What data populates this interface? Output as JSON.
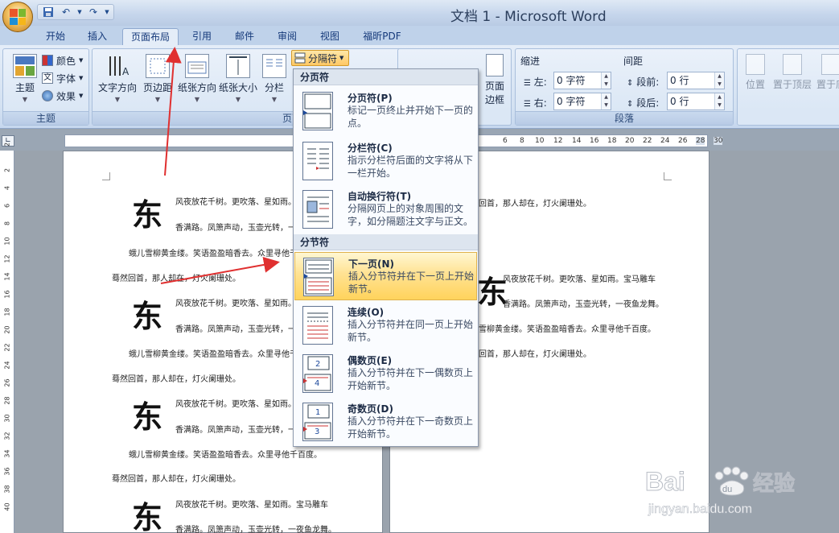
{
  "window": {
    "title": "文档 1 - Microsoft Word"
  },
  "tabs": [
    {
      "label": "开始"
    },
    {
      "label": "插入"
    },
    {
      "label": "页面布局"
    },
    {
      "label": "引用"
    },
    {
      "label": "邮件"
    },
    {
      "label": "审阅"
    },
    {
      "label": "视图"
    },
    {
      "label": "福昕PDF"
    }
  ],
  "ribbon": {
    "theme_group": {
      "label": "主题",
      "theme": "主题",
      "colors": "颜色",
      "fonts": "字体",
      "effects": "效果"
    },
    "page_setup_group": {
      "label": "页面设置",
      "text_direction": "文字方向",
      "margins": "页边距",
      "orientation": "纸张方向",
      "size": "纸张大小",
      "columns": "分栏",
      "breaks": "分隔符"
    },
    "page_bg": {
      "borders_line1": "页面",
      "borders_line2": "边框"
    },
    "paragraph_group": {
      "label": "段落",
      "indent": "缩进",
      "spacing": "间距",
      "left": "左:",
      "right": "右:",
      "before": "段前:",
      "after": "段后:",
      "left_value": "0 字符",
      "right_value": "0 字符",
      "before_value": "0 行",
      "after_value": "0 行"
    },
    "arrange_group": {
      "position": "位置",
      "bring_front": "置于顶层",
      "send_back": "置于底"
    }
  },
  "ruler": {
    "h_ticks": [
      "6",
      "8",
      "10",
      "12",
      "14",
      "16",
      "18",
      "20",
      "22",
      "24",
      "26",
      "28",
      "30"
    ],
    "v_ticks": [
      "2",
      "2",
      "4",
      "6",
      "8",
      "10",
      "12",
      "14",
      "16",
      "18",
      "20",
      "22",
      "24",
      "26",
      "28",
      "30",
      "32",
      "34",
      "36",
      "38",
      "40"
    ]
  },
  "document": {
    "big_char": "东",
    "line1": "风夜放花千树。更吹落、星如雨。宝马雕车",
    "line2": "香满路。凤箫声动，玉壶光转，一夜鱼龙舞。",
    "line3": "蛾儿雪柳黄金缕。笑语盈盈暗香去。众里寻他千百度。",
    "line4": "蓦然回首，那人却在，灯火阑珊处。",
    "right_top": "回首，那人却在，灯火阑珊处。",
    "right_line1": "风夜放花千树。更吹落、星如雨。宝马雕车",
    "right_line2": "香满路。凤箫声动，玉壶光转，一夜鱼龙舞。",
    "right_line3": "雪柳黄金缕。笑语盈盈暗香去。众里寻他千百度。",
    "right_line4": "回首，那人却在，灯火阑珊处。"
  },
  "dropdown": {
    "page_breaks_header": "分页符",
    "section_breaks_header": "分节符",
    "items": [
      {
        "title": "分页符(P)",
        "desc": "标记一页终止并开始下一页的点。"
      },
      {
        "title": "分栏符(C)",
        "desc": "指示分栏符后面的文字将从下一栏开始。"
      },
      {
        "title": "自动换行符(T)",
        "desc": "分隔网页上的对象周围的文字，如分隔题注文字与正文。"
      },
      {
        "title": "下一页(N)",
        "desc": "插入分节符并在下一页上开始新节。"
      },
      {
        "title": "连续(O)",
        "desc": "插入分节符并在同一页上开始新节。"
      },
      {
        "title": "偶数页(E)",
        "desc": "插入分节符并在下一偶数页上开始新节。"
      },
      {
        "title": "奇数页(D)",
        "desc": "插入分节符并在下一奇数页上开始新节。"
      }
    ]
  },
  "watermark": {
    "brand": "Bai 经验",
    "du": "du",
    "url": "jingyan.baidu.com"
  },
  "colors": {
    "ribbon": "#d3e1f2",
    "highlight": "#ffd35c",
    "arrow": "#e03030"
  }
}
